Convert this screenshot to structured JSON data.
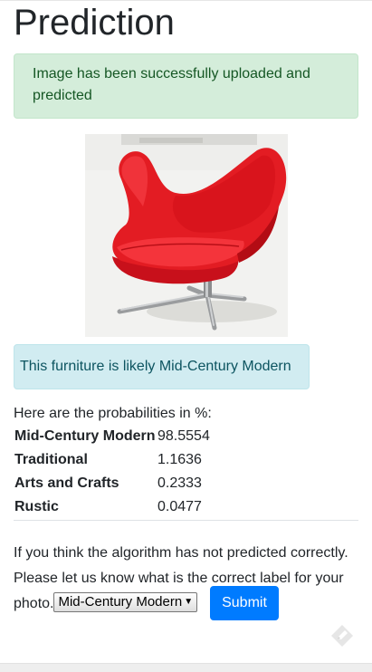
{
  "page": {
    "title": "Prediction"
  },
  "alert_success": {
    "text": "Image has been successfully uploaded and predicted"
  },
  "image": {
    "subject": "red egg chair",
    "icon_name": "uploaded-furniture-photo"
  },
  "alert_info": {
    "text": "This furniture is likely Mid-Century Modern"
  },
  "probabilities": {
    "intro": "Here are the probabilities in %:",
    "rows": [
      {
        "label": "Mid-Century Modern",
        "value": "98.5554"
      },
      {
        "label": "Traditional",
        "value": "1.1636"
      },
      {
        "label": "Arts and Crafts",
        "value": "0.2333"
      },
      {
        "label": "Rustic",
        "value": "0.0477"
      }
    ]
  },
  "feedback": {
    "text": "If you think the algorithm has not predicted correctly. Please let us know what is the correct label for your photo.",
    "select_value": "Mid-Century Modern",
    "submit_label": "Submit",
    "icon_name": "pencil-icon"
  },
  "colors": {
    "success_bg": "#d4edda",
    "success_text": "#155724",
    "info_bg": "#d1ecf1",
    "info_text": "#0c5460",
    "primary": "#007bff"
  }
}
